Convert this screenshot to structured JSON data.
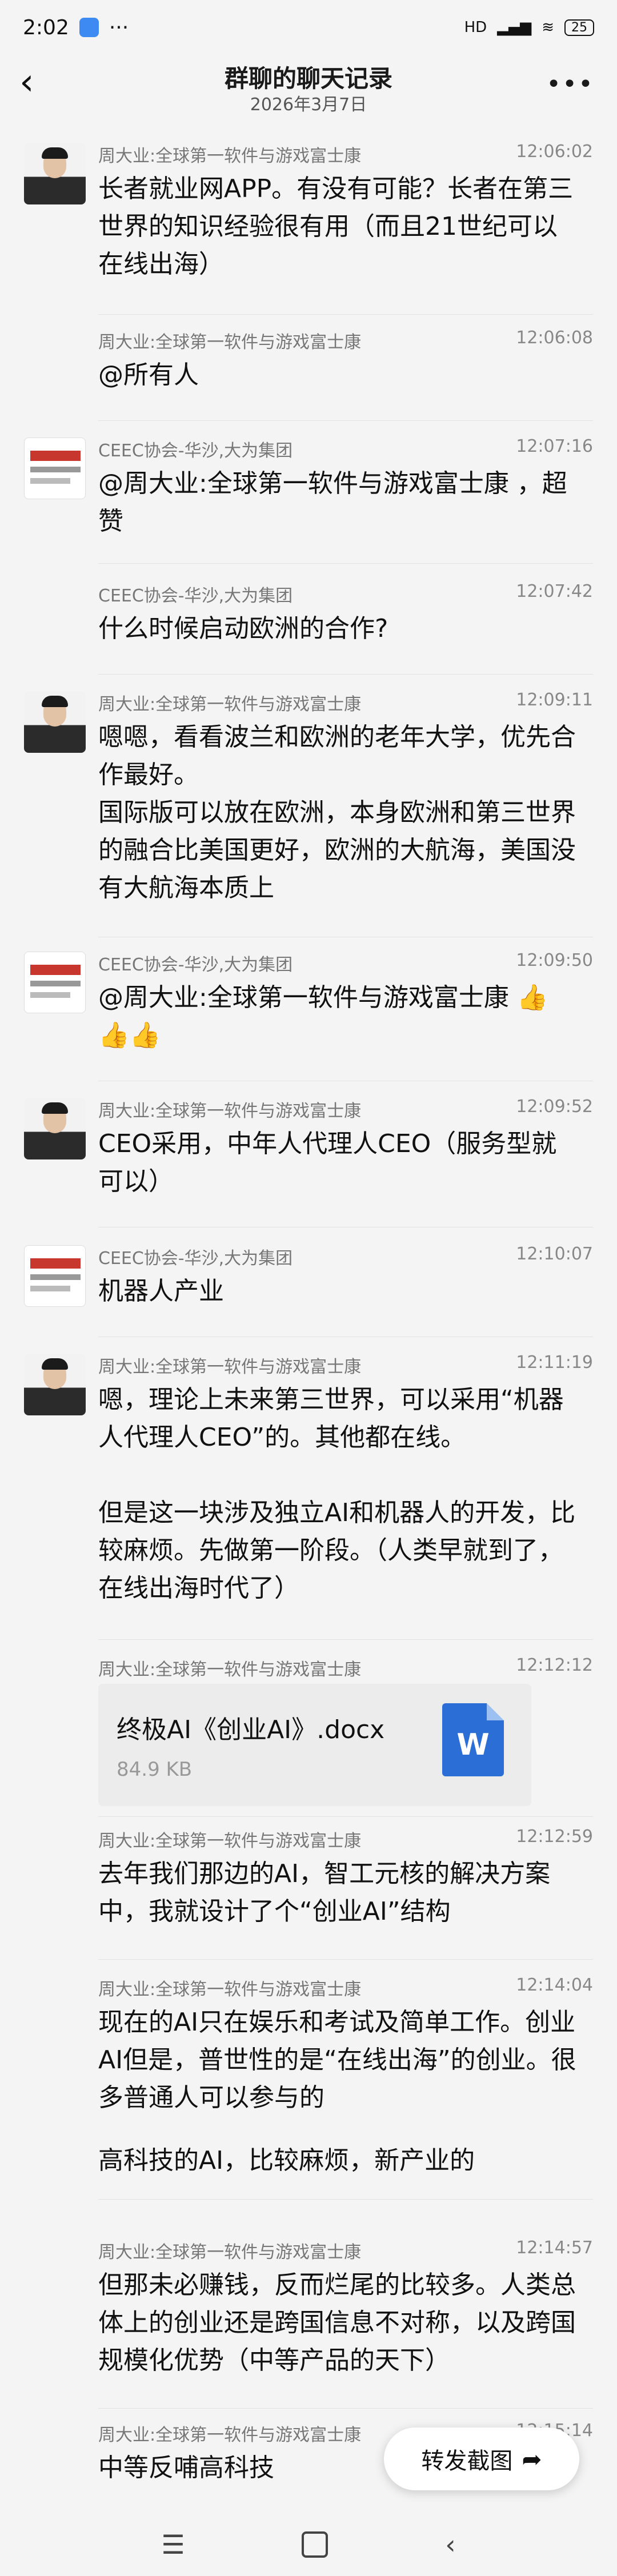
{
  "status_bar": {
    "time": "2:02",
    "signal": "HD",
    "wifi": "WiFi",
    "battery": "25"
  },
  "header": {
    "back_icon": "back-arrow-icon",
    "title": "群聊的聊天记录",
    "subtitle": "2026年3月7日",
    "more_icon": "more-icon"
  },
  "messages": [
    {
      "sender": "周大业:全球第一软件与游戏富士康",
      "time": "12:06:02",
      "avatar": "person",
      "text": "长者就业网APP。有没有可能？长者在第三世界的知识经验很有用（而且21世纪可以在线出海）"
    },
    {
      "sender": "周大业:全球第一软件与游戏富士康",
      "time": "12:06:08",
      "avatar": "none",
      "text": "@所有人"
    },
    {
      "sender": "CEEC协会-华沙,大为集团",
      "time": "12:07:16",
      "avatar": "org",
      "text": "@周大业:全球第一软件与游戏富士康 ，超赞"
    },
    {
      "sender": "CEEC协会-华沙,大为集团",
      "time": "12:07:42",
      "avatar": "none",
      "text": "什么时候启动欧洲的合作?"
    },
    {
      "sender": "周大业:全球第一软件与游戏富士康",
      "time": "12:09:11",
      "avatar": "person",
      "text": "嗯嗯，看看波兰和欧洲的老年大学，优先合作最好。\n国际版可以放在欧洲，本身欧洲和第三世界的融合比美国更好，欧洲的大航海，美国没有大航海本质上"
    },
    {
      "sender": "CEEC协会-华沙,大为集团",
      "time": "12:09:50",
      "avatar": "org",
      "text": "@周大业:全球第一软件与游戏富士康 👍👍👍"
    },
    {
      "sender": "周大业:全球第一软件与游戏富士康",
      "time": "12:09:52",
      "avatar": "person",
      "text": "CEO采用，中年人代理人CEO（服务型就可以）"
    },
    {
      "sender": "CEEC协会-华沙,大为集团",
      "time": "12:10:07",
      "avatar": "org",
      "text": "机器人产业"
    },
    {
      "sender": "周大业:全球第一软件与游戏富士康",
      "time": "12:11:19",
      "avatar": "person",
      "text": "嗯，理论上未来第三世界，可以采用“机器人代理人CEO”的。其他都在线。\n\n但是这一块涉及独立AI和机器人的开发，比较麻烦。先做第一阶段。（人类早就到了，在线出海时代了）"
    },
    {
      "sender": "周大业:全球第一软件与游戏富士康",
      "time": "12:12:12",
      "avatar": "none",
      "file": {
        "name": "终极AI《创业AI》.docx",
        "size": "84.9 KB",
        "icon": "word-doc-icon",
        "icon_label": "W"
      }
    },
    {
      "sender": "周大业:全球第一软件与游戏富士康",
      "time": "12:12:59",
      "avatar": "none",
      "text": "去年我们那边的AI，智工元核的解决方案中，我就设计了个“创业AI”结构"
    },
    {
      "sender": "周大业:全球第一软件与游戏富士康",
      "time": "12:14:04",
      "avatar": "none",
      "text": "现在的AI只在娱乐和考试及简单工作。创业AI但是，普世性的是“在线出海”的创业。很多普通人可以参与的"
    },
    {
      "sender": "",
      "time": "",
      "avatar": "none",
      "text": "高科技的AI，比较麻烦，新产业的"
    },
    {
      "sender": "周大业:全球第一软件与游戏富士康",
      "time": "12:14:57",
      "avatar": "none",
      "text": "但那未必赚钱，反而烂尾的比较多。人类总体上的创业还是跨国信息不对称，以及跨国规模化优势（中等产品的天下）"
    },
    {
      "sender": "周大业:全球第一软件与游戏富士康",
      "time": "12:15:14",
      "avatar": "none",
      "text": "中等反哺高科技"
    }
  ],
  "forward_button": {
    "label": "转发截图",
    "icon": "forward-arrow-icon"
  },
  "nav_bar": {
    "menu_icon": "menu-icon",
    "home_icon": "home-icon",
    "back_icon": "nav-back-icon"
  }
}
